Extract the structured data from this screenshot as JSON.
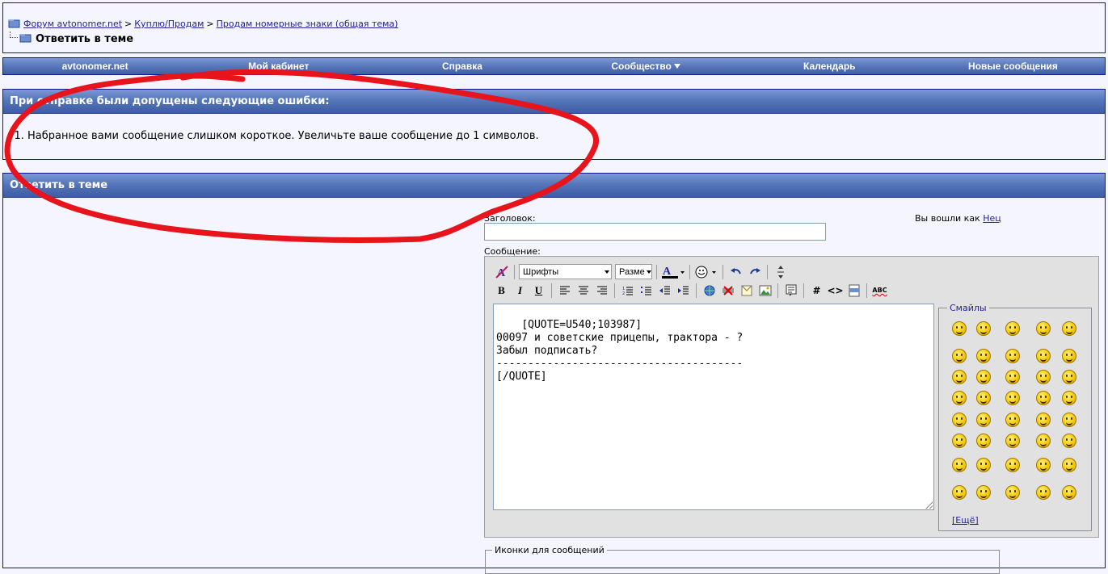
{
  "breadcrumb": {
    "items": [
      "Форум avtonomer.net",
      "Куплю/Продам",
      "Продам номерные знаки (общая тема)"
    ],
    "separator": ">",
    "current": "Ответить в теме"
  },
  "navbar": {
    "items": [
      "avtonomer.net",
      "Мой кабинет",
      "Справка",
      "Сообщество",
      "Календарь",
      "Новые сообщения"
    ]
  },
  "errors": {
    "title": "При отправке были допущены следующие ошибки:",
    "list": [
      "Набранное вами сообщение слишком короткое. Увеличьте ваше сообщение до 1 символов."
    ]
  },
  "reply": {
    "title": "Ответить в теме",
    "title_label": "Заголовок:",
    "title_value": "",
    "logged_in_label": "Вы вошли как",
    "username": "Нец",
    "message_label": "Сообщение:"
  },
  "editor": {
    "font_select": "Шрифты",
    "size_select": "Разме",
    "message_text": "[QUOTE=U540;103987]\n00097 и советские прицепы, трактора - ?\nЗабыл подписать?\n---------------------------------------\n[/QUOTE]",
    "buttons": {
      "bold": "B",
      "italic": "I",
      "underline": "U",
      "hash": "#",
      "code": "<>",
      "spell": "ABC"
    }
  },
  "smilies": {
    "legend": "Смайлы",
    "more": "[Ещё]",
    "count": 40
  },
  "icons_box": {
    "legend": "Иконки для сообщений"
  },
  "colors": {
    "annotation_red": "#e8141c",
    "header_blue": "#5576ba",
    "border_navy": "#0b198c"
  }
}
